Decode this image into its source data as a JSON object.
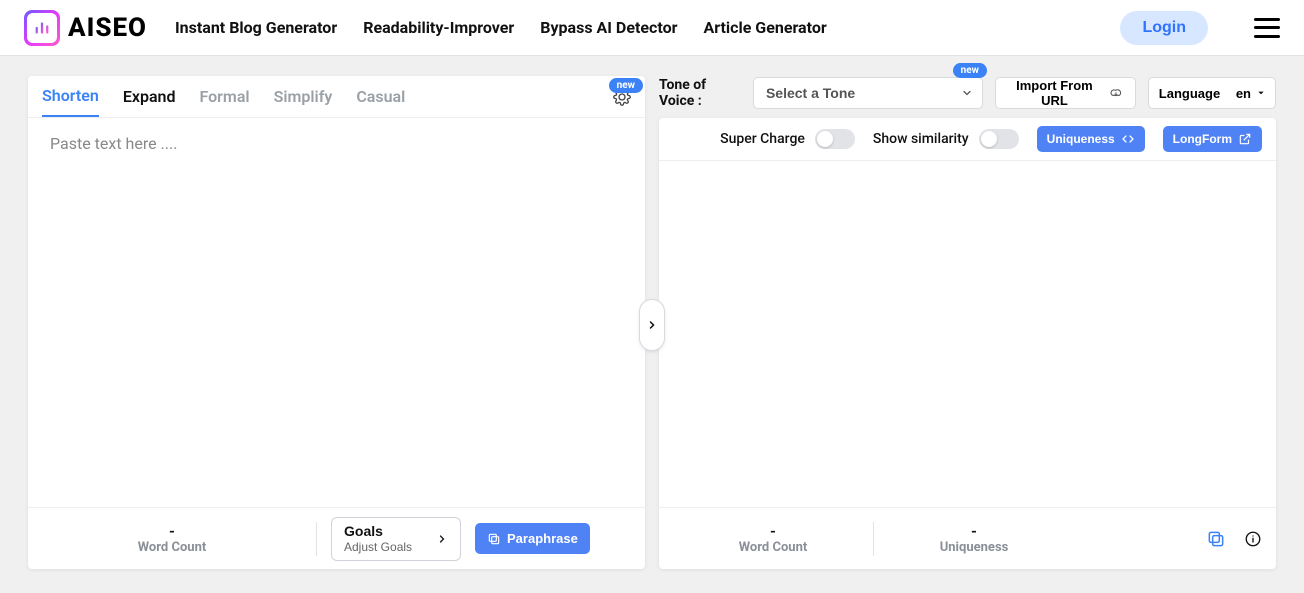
{
  "brand": {
    "name": "AISEO"
  },
  "nav": {
    "items": [
      "Instant Blog Generator",
      "Readability-Improver",
      "Bypass AI Detector",
      "Article Generator"
    ],
    "login": "Login"
  },
  "badges": {
    "new": "new"
  },
  "left": {
    "tabs": {
      "shorten": "Shorten",
      "expand": "Expand",
      "formal": "Formal",
      "simplify": "Simplify",
      "casual": "Casual"
    },
    "placeholder": "Paste text here ....",
    "footer": {
      "word_count_value": "-",
      "word_count_label": "Word Count",
      "goals_title": "Goals",
      "goals_sub": "Adjust Goals",
      "paraphrase": "Paraphrase"
    }
  },
  "controls": {
    "tone_label": "Tone of Voice :",
    "tone_placeholder": "Select a Tone",
    "import": "Import From URL",
    "language_label": "Language",
    "language_value": "en"
  },
  "right": {
    "super_charge": "Super Charge",
    "show_similarity": "Show similarity",
    "uniqueness_btn": "Uniqueness",
    "longform_btn": "LongForm",
    "footer": {
      "word_count_value": "-",
      "word_count_label": "Word Count",
      "uniqueness_value": "-",
      "uniqueness_label": "Uniqueness"
    }
  }
}
